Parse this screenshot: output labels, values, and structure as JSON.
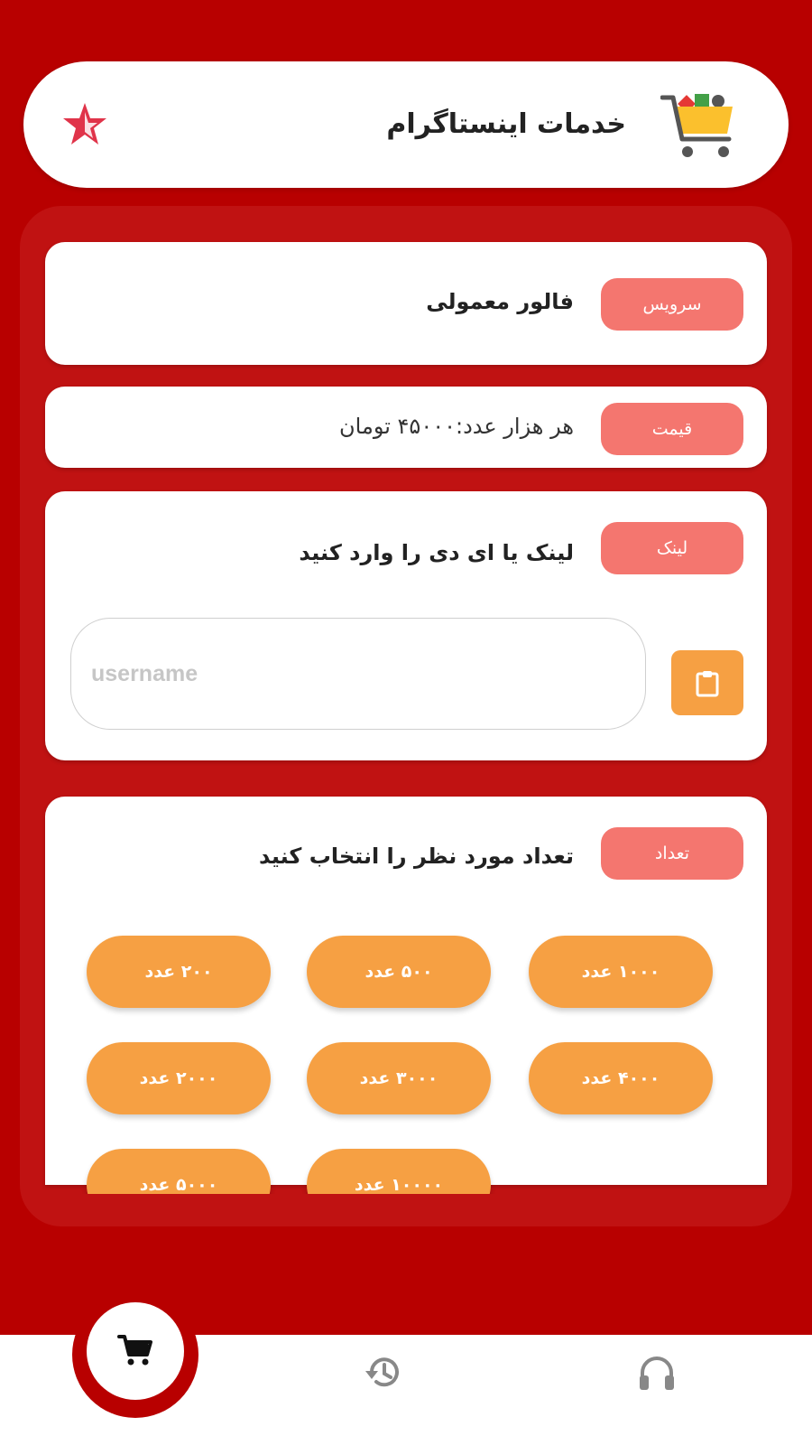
{
  "header": {
    "title": "خدمات اینستاگرام",
    "cart_icon": "shopping-cart-icon",
    "star_icon": "star-icon",
    "accent_color": "#e0344a"
  },
  "service": {
    "tag": "سرویس",
    "value": "فالور معمولی"
  },
  "price": {
    "tag": "قیمت",
    "value": "هر هزار عدد:۴۵۰۰۰ تومان"
  },
  "link": {
    "tag": "لینک",
    "prompt": "لینک یا ای دی را وارد کنید",
    "input_placeholder": "username",
    "input_value": "",
    "paste_icon": "clipboard-icon"
  },
  "quantity": {
    "tag": "تعداد",
    "prompt": "تعداد مورد نظر را انتخاب کنید",
    "options": [
      "۱۰۰۰ عدد",
      "۵۰۰ عدد",
      "۲۰۰ عدد",
      "۴۰۰۰ عدد",
      "۳۰۰۰ عدد",
      "۲۰۰۰ عدد",
      "۱۰۰۰۰ عدد",
      "۵۰۰۰ عدد"
    ]
  },
  "nav": {
    "items": [
      "shopping-cart-icon",
      "history-icon",
      "headset-icon"
    ],
    "active": "shopping-cart-icon"
  },
  "colors": {
    "background": "#b80000",
    "tag": "#f4766f",
    "button": "#f6a043"
  }
}
